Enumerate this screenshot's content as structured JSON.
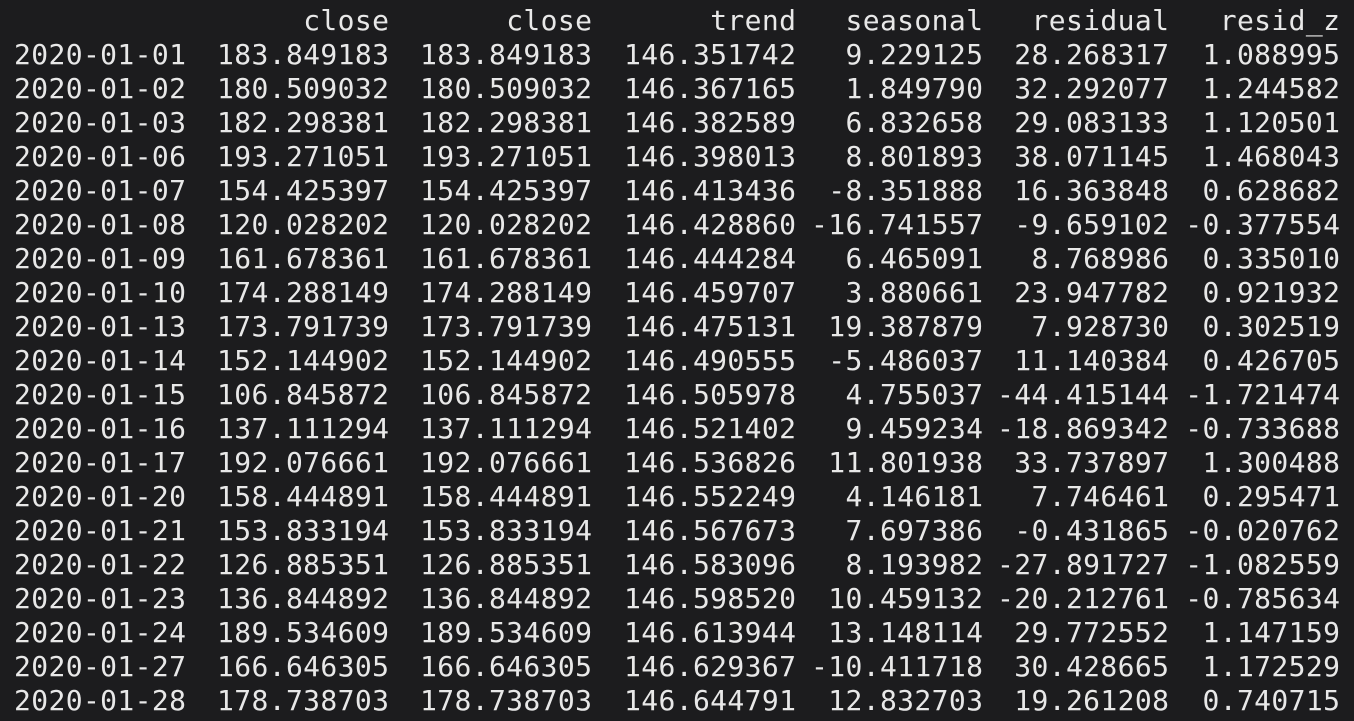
{
  "columns": [
    "",
    "close",
    "close",
    "trend",
    "seasonal",
    "residual",
    "resid_z"
  ],
  "rows": [
    [
      "2020-01-01",
      "183.849183",
      "183.849183",
      "146.351742",
      "9.229125",
      "28.268317",
      "1.088995"
    ],
    [
      "2020-01-02",
      "180.509032",
      "180.509032",
      "146.367165",
      "1.849790",
      "32.292077",
      "1.244582"
    ],
    [
      "2020-01-03",
      "182.298381",
      "182.298381",
      "146.382589",
      "6.832658",
      "29.083133",
      "1.120501"
    ],
    [
      "2020-01-06",
      "193.271051",
      "193.271051",
      "146.398013",
      "8.801893",
      "38.071145",
      "1.468043"
    ],
    [
      "2020-01-07",
      "154.425397",
      "154.425397",
      "146.413436",
      "-8.351888",
      "16.363848",
      "0.628682"
    ],
    [
      "2020-01-08",
      "120.028202",
      "120.028202",
      "146.428860",
      "-16.741557",
      "-9.659102",
      "-0.377554"
    ],
    [
      "2020-01-09",
      "161.678361",
      "161.678361",
      "146.444284",
      "6.465091",
      "8.768986",
      "0.335010"
    ],
    [
      "2020-01-10",
      "174.288149",
      "174.288149",
      "146.459707",
      "3.880661",
      "23.947782",
      "0.921932"
    ],
    [
      "2020-01-13",
      "173.791739",
      "173.791739",
      "146.475131",
      "19.387879",
      "7.928730",
      "0.302519"
    ],
    [
      "2020-01-14",
      "152.144902",
      "152.144902",
      "146.490555",
      "-5.486037",
      "11.140384",
      "0.426705"
    ],
    [
      "2020-01-15",
      "106.845872",
      "106.845872",
      "146.505978",
      "4.755037",
      "-44.415144",
      "-1.721474"
    ],
    [
      "2020-01-16",
      "137.111294",
      "137.111294",
      "146.521402",
      "9.459234",
      "-18.869342",
      "-0.733688"
    ],
    [
      "2020-01-17",
      "192.076661",
      "192.076661",
      "146.536826",
      "11.801938",
      "33.737897",
      "1.300488"
    ],
    [
      "2020-01-20",
      "158.444891",
      "158.444891",
      "146.552249",
      "4.146181",
      "7.746461",
      "0.295471"
    ],
    [
      "2020-01-21",
      "153.833194",
      "153.833194",
      "146.567673",
      "7.697386",
      "-0.431865",
      "-0.020762"
    ],
    [
      "2020-01-22",
      "126.885351",
      "126.885351",
      "146.583096",
      "8.193982",
      "-27.891727",
      "-1.082559"
    ],
    [
      "2020-01-23",
      "136.844892",
      "136.844892",
      "146.598520",
      "10.459132",
      "-20.212761",
      "-0.785634"
    ],
    [
      "2020-01-24",
      "189.534609",
      "189.534609",
      "146.613944",
      "13.148114",
      "29.772552",
      "1.147159"
    ],
    [
      "2020-01-27",
      "166.646305",
      "166.646305",
      "146.629367",
      "-10.411718",
      "30.428665",
      "1.172529"
    ],
    [
      "2020-01-28",
      "178.738703",
      "178.738703",
      "146.644791",
      "12.832703",
      "19.261208",
      "0.740715"
    ]
  ]
}
